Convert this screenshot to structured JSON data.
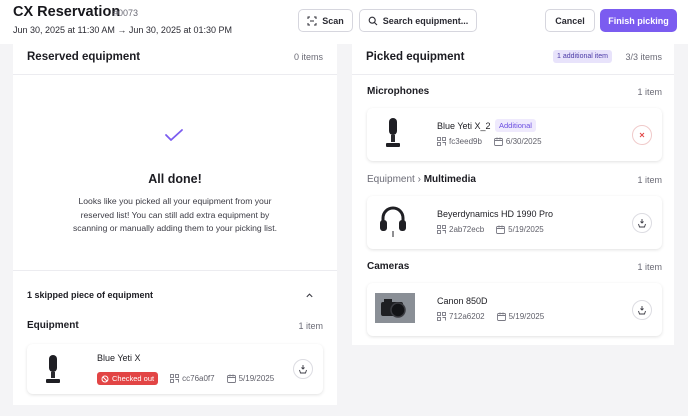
{
  "header": {
    "title": "CX Reservation",
    "reservation_no": "#0073",
    "dates": "Jun 30, 2025 at 11:30 AM → Jun 30, 2025 at 01:30 PM",
    "scan_label": "Scan",
    "search_label": "Search equipment...",
    "cancel_label": "Cancel",
    "finish_label": "Finish picking"
  },
  "reserved": {
    "title": "Reserved equipment",
    "count": "0 items",
    "done_title": "All done!",
    "done_text": "Looks like you picked all your equipment from your reserved list! You can still add extra equipment by scanning or manually adding them to your picking list.",
    "skipped_label": "1 skipped piece of equipment",
    "section_title": "Equipment",
    "section_count": "1 item",
    "item": {
      "name": "Blue Yeti X",
      "status": "Checked out",
      "code": "cc76a0f7",
      "date": "5/19/2025"
    }
  },
  "picked": {
    "title": "Picked equipment",
    "additional_pill": "1 additional item",
    "count": "3/3 items",
    "groups": [
      {
        "title": "Microphones",
        "count": "1 item",
        "item": {
          "name": "Blue Yeti X_2",
          "badge": "Additional",
          "code": "fc3eed9b",
          "date": "6/30/2025"
        }
      },
      {
        "title_prefix": "Equipment",
        "separator": "›",
        "title": "Multimedia",
        "count": "1 item",
        "item": {
          "name": "Beyerdynamics HD 1990 Pro",
          "code": "2ab72ecb",
          "date": "5/19/2025"
        }
      },
      {
        "title": "Cameras",
        "count": "1 item",
        "item": {
          "name": "Canon 850D",
          "code": "712a6202",
          "date": "5/19/2025"
        }
      }
    ]
  },
  "colors": {
    "accent": "#7b5cf0",
    "danger": "#e24545",
    "badge_bg": "#efeafd"
  },
  "icons": [
    "scan-icon",
    "search-icon",
    "check-icon",
    "chevron-up-icon",
    "barcode-icon",
    "calendar-icon",
    "unpick-icon",
    "remove-icon",
    "ban-icon"
  ]
}
